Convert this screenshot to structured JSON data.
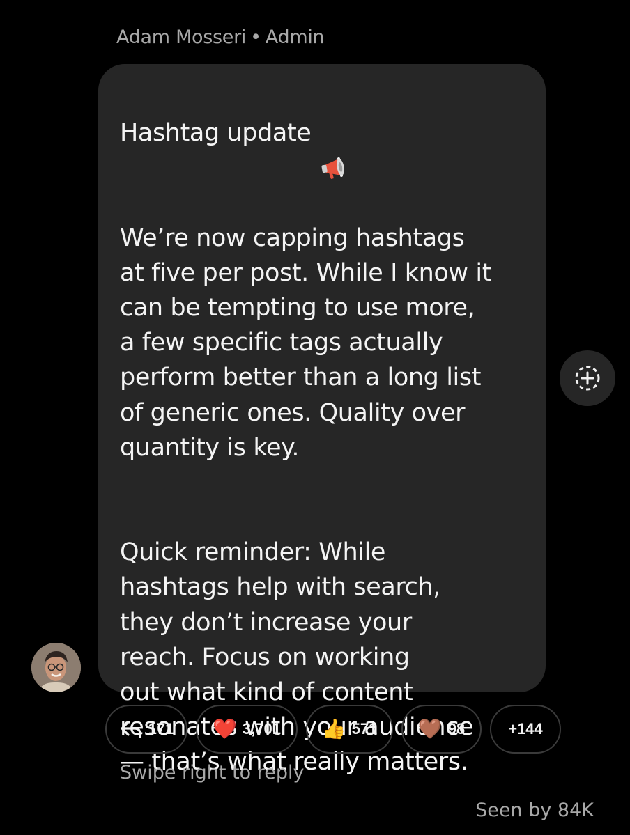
{
  "header": {
    "sender_name": "Adam Mosseri",
    "separator": "•",
    "sender_role": "Admin"
  },
  "message": {
    "title": "Hashtag update",
    "title_emoji": "megaphone-icon",
    "paragraph_1": "We’re now capping hashtags\nat five per post. While I know it\ncan be tempting to use more,\na few specific tags actually\nperform better than a long list\nof generic ones. Quality over\nquantity is key.",
    "paragraph_2": "Quick reminder: While\nhashtags help with search,\nthey don’t increase your\nreach. Focus on working\nout what kind of content\nresonates with your audience\n— that’s what really matters."
  },
  "reactions": {
    "replies": {
      "icon": "reply-arrow-icon",
      "count": "171"
    },
    "heart": {
      "emoji": "❤️",
      "count": "3,701"
    },
    "thumbs_up": {
      "emoji": "👍",
      "count": "571"
    },
    "brown_heart": {
      "emoji": "🤎",
      "count": "98"
    },
    "more": {
      "label": "+144"
    }
  },
  "footer": {
    "hint": "Swipe right to reply",
    "seen": "Seen by 84K"
  },
  "colors": {
    "background": "#000000",
    "bubble": "#262626",
    "muted_text": "#a8a8a8",
    "pill_border": "#3a3a3a"
  }
}
